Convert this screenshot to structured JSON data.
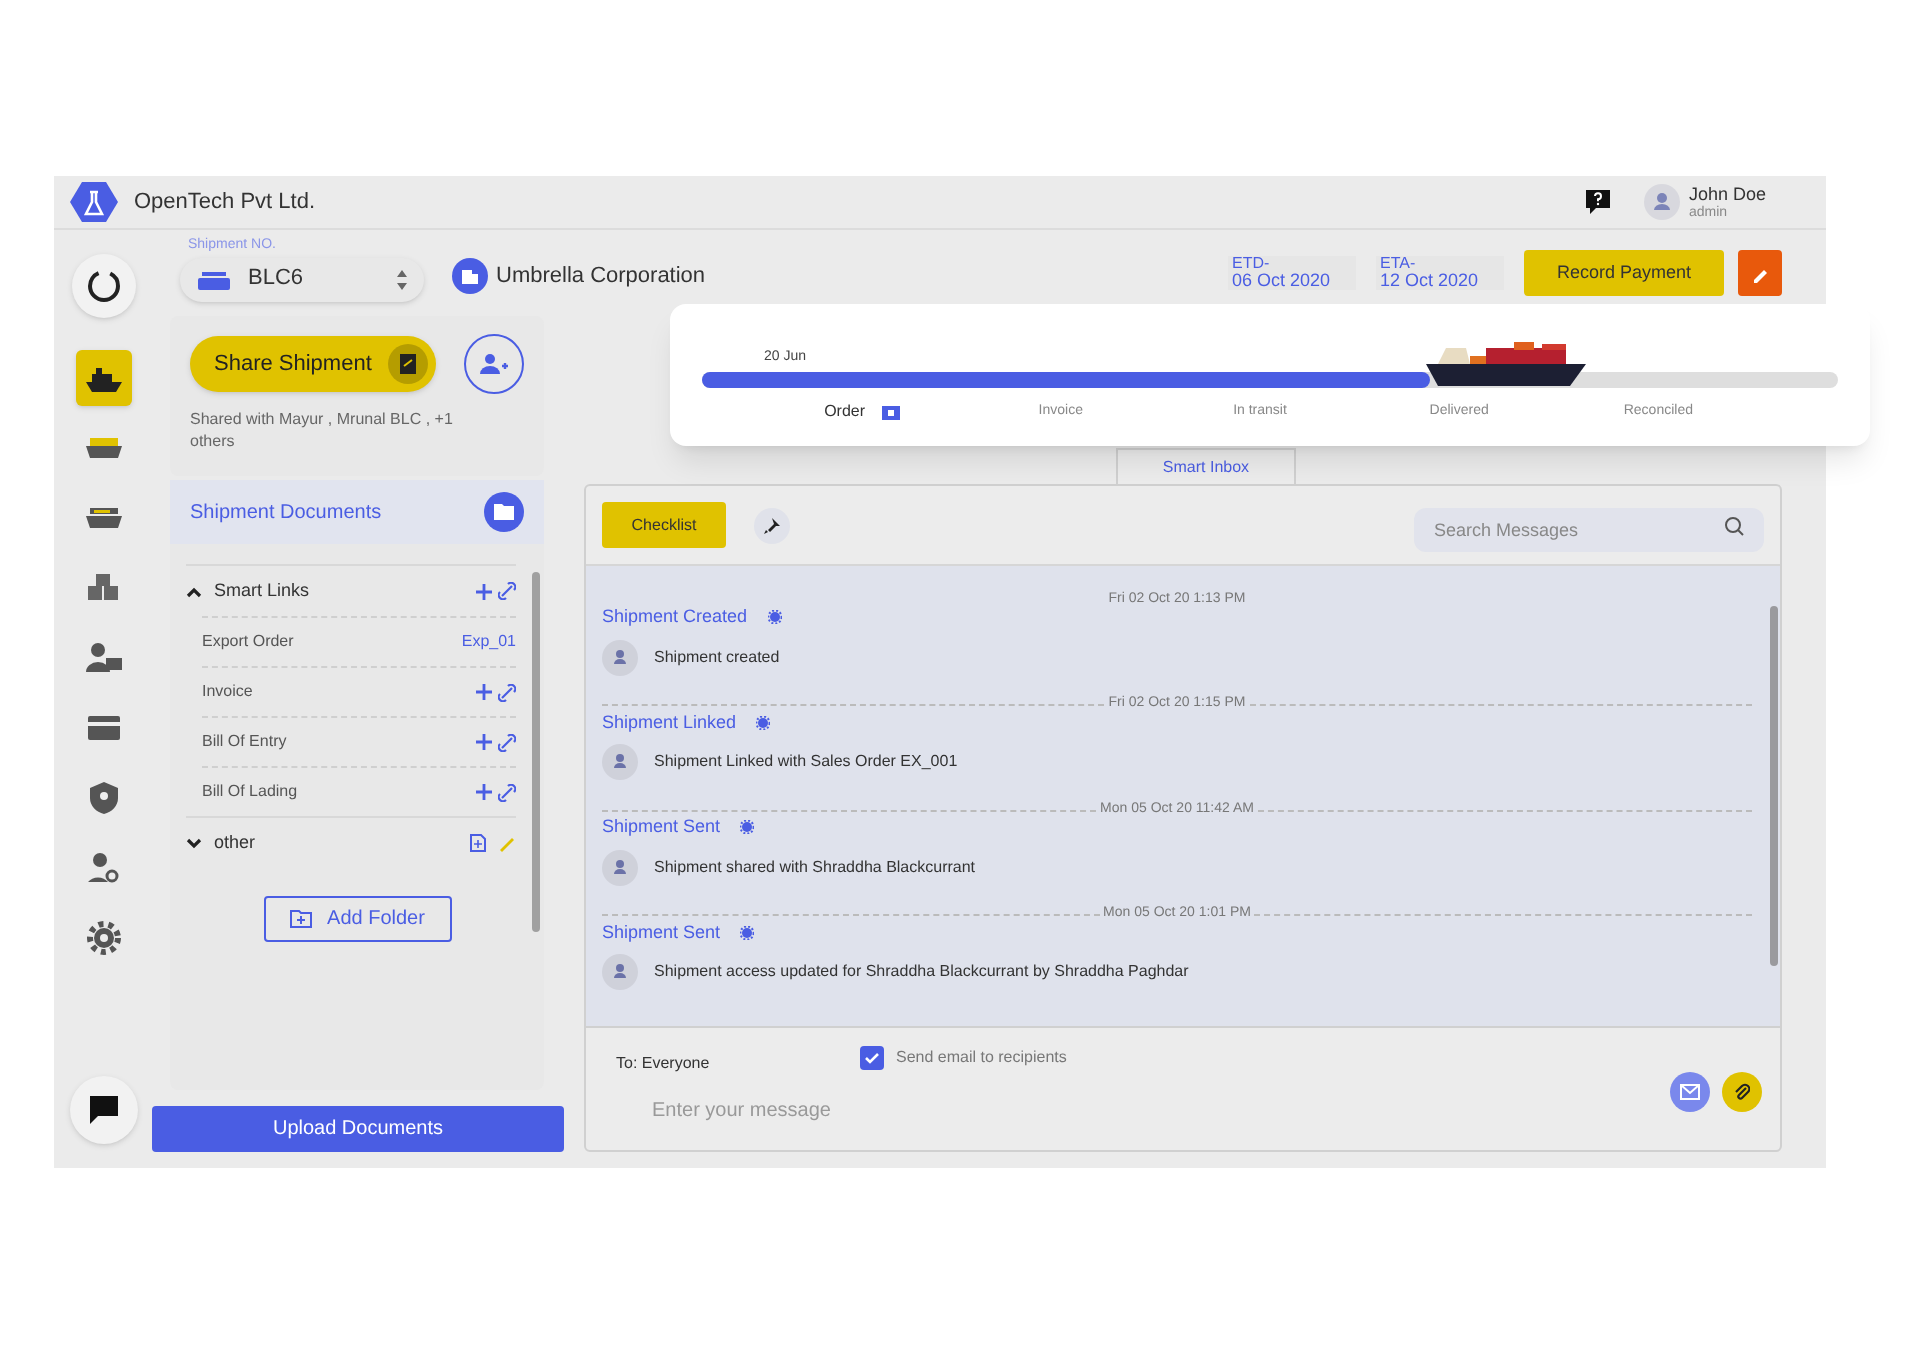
{
  "header": {
    "company": "OpenTech Pvt Ltd.",
    "user_name": "John Doe",
    "user_role": "admin"
  },
  "sidebar": {
    "items": [
      {
        "kind": "ship",
        "selected": true
      },
      {
        "kind": "cargo",
        "selected": false
      },
      {
        "kind": "truck",
        "selected": false
      },
      {
        "kind": "crates",
        "selected": false
      },
      {
        "kind": "person-card",
        "selected": false
      },
      {
        "kind": "card",
        "selected": false
      },
      {
        "kind": "shield",
        "selected": false
      },
      {
        "kind": "person-search",
        "selected": false
      },
      {
        "kind": "gear",
        "selected": false
      }
    ]
  },
  "shipment": {
    "label": "Shipment NO.",
    "number": "BLC6",
    "company": "Umbrella Corporation",
    "etd_label": "ETD-",
    "etd": "06 Oct 2020",
    "eta_label": "ETA-",
    "eta": "12 Oct 2020",
    "record_payment": "Record Payment"
  },
  "share": {
    "button": "Share Shipment",
    "shared_with": "Shared with Mayur , Mrunal BLC , +1 others"
  },
  "documents": {
    "title": "Shipment Documents",
    "folders": [
      {
        "name": "Smart Links",
        "expanded": true,
        "kind": "links",
        "children": [
          {
            "name": "Export Order",
            "link": "Exp_01"
          },
          {
            "name": "Invoice"
          },
          {
            "name": "Bill Of Entry"
          },
          {
            "name": "Bill Of Lading"
          }
        ]
      },
      {
        "name": "other",
        "expanded": false,
        "kind": "files"
      }
    ],
    "add_folder": "Add Folder",
    "upload": "Upload Documents"
  },
  "progress": {
    "date": "20 Jun",
    "level": 0.64,
    "stages": [
      {
        "label": "Order",
        "current": true
      },
      {
        "label": "Invoice",
        "current": false
      },
      {
        "label": "In transit",
        "current": false
      },
      {
        "label": "Delivered",
        "current": false
      },
      {
        "label": "Reconciled",
        "current": false
      }
    ]
  },
  "inbox": {
    "tab": "Smart Inbox",
    "checklist": "Checklist",
    "search_placeholder": "Search Messages",
    "messages": [
      {
        "time": "Fri 02 Oct 20 1:13 PM",
        "title": "Shipment Created",
        "body": "Shipment created"
      },
      {
        "time": "Fri 02 Oct 20 1:15 PM",
        "title": "Shipment Linked",
        "body": "Shipment Linked with Sales Order EX_001"
      },
      {
        "time": "Mon 05 Oct 20 11:42 AM",
        "title": "Shipment Sent",
        "body": "Shipment shared with Shraddha Blackcurrant"
      },
      {
        "time": "Mon 05 Oct 20 1:01 PM",
        "title": "Shipment Sent",
        "body": "Shipment access updated for Shraddha Blackcurrant by Shraddha Paghdar"
      }
    ],
    "to": "To: Everyone",
    "send_email": {
      "label": "Send email to recipients",
      "checked": true
    },
    "message_placeholder": "Enter your message"
  }
}
